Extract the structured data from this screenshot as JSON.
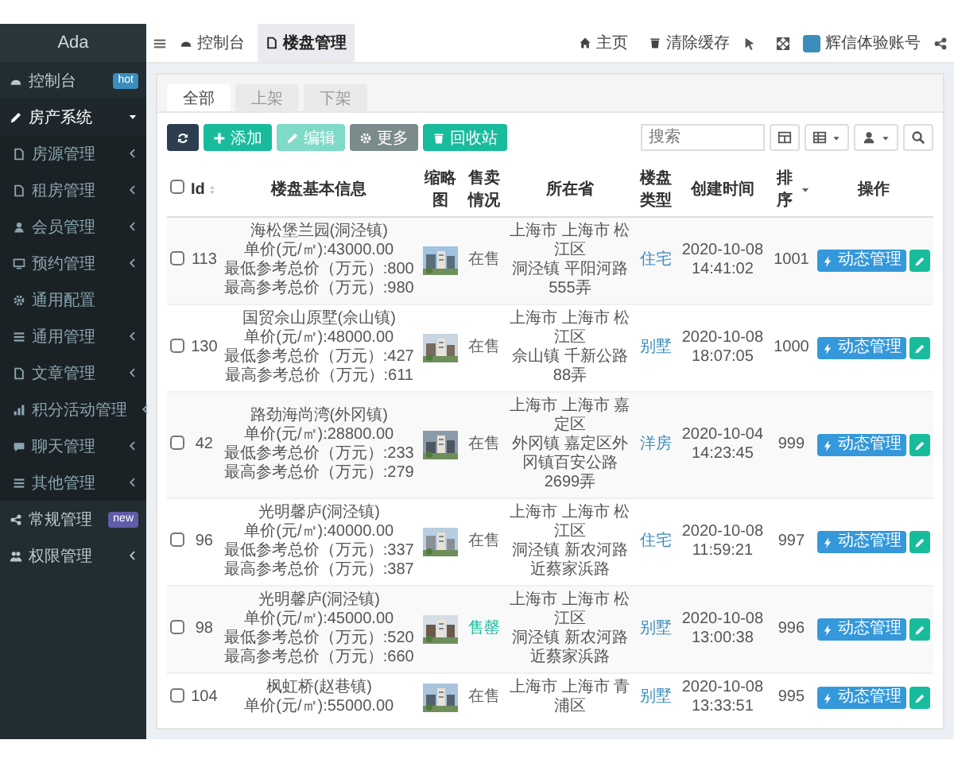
{
  "sidebar": {
    "logo": "Ada",
    "items": [
      {
        "label": "控制台",
        "kind": "link",
        "selected": false,
        "badge": {
          "text": "hot",
          "color": "#3c8dbc"
        }
      },
      {
        "label": "房产系统",
        "kind": "group",
        "selected": true,
        "expanded": true,
        "children": [
          {
            "label": "房源管理",
            "kind": "group",
            "selected": false,
            "expanded": false
          },
          {
            "label": "租房管理",
            "kind": "group",
            "selected": false,
            "expanded": false
          },
          {
            "label": "会员管理",
            "kind": "group",
            "selected": false,
            "expanded": false
          },
          {
            "label": "预约管理",
            "kind": "group",
            "selected": false,
            "expanded": false
          },
          {
            "label": "通用配置",
            "kind": "link",
            "selected": false
          },
          {
            "label": "通用管理",
            "kind": "group",
            "selected": false,
            "expanded": false
          },
          {
            "label": "文章管理",
            "kind": "group",
            "selected": false,
            "expanded": false
          },
          {
            "label": "积分活动管理",
            "kind": "group",
            "selected": false,
            "expanded": false
          },
          {
            "label": "聊天管理",
            "kind": "group",
            "selected": false,
            "expanded": false
          },
          {
            "label": "其他管理",
            "kind": "group",
            "selected": false,
            "expanded": false
          }
        ]
      },
      {
        "label": "常规管理",
        "kind": "link",
        "selected": false,
        "badge": {
          "text": "new",
          "color": "#605ca8"
        }
      },
      {
        "label": "权限管理",
        "kind": "group",
        "selected": false,
        "expanded": false
      }
    ]
  },
  "topbar": {
    "nav_tabs": [
      {
        "label": "控制台",
        "selected": false
      },
      {
        "label": "楼盘管理",
        "selected": true
      }
    ],
    "links": [
      {
        "label": "主页"
      },
      {
        "label": "清除缓存"
      }
    ],
    "user": {
      "name": "辉信体验账号"
    }
  },
  "filter_tabs": [
    {
      "label": "全部",
      "selected": true
    },
    {
      "label": "上架",
      "selected": false
    },
    {
      "label": "下架",
      "selected": false
    }
  ],
  "toolbar": {
    "buttons": [
      {
        "kind": "refresh",
        "disabled": false
      },
      {
        "kind": "add",
        "label": "添加",
        "disabled": false
      },
      {
        "kind": "edit",
        "label": "编辑",
        "disabled": true
      },
      {
        "kind": "more",
        "label": "更多",
        "disabled": false
      },
      {
        "kind": "recycle",
        "label": "回收站",
        "disabled": false
      }
    ],
    "search": {
      "placeholder": "搜索"
    }
  },
  "table": {
    "all_checked": false,
    "columns": [
      {
        "label": "Id",
        "kind": "sortable"
      },
      {
        "label": "楼盘基本信息",
        "kind": "plain"
      },
      {
        "label": "缩略图",
        "kind": "plain"
      },
      {
        "label": "售卖情况",
        "kind": "plain"
      },
      {
        "label": "所在省",
        "kind": "plain"
      },
      {
        "label": "楼盘类型",
        "kind": "plain"
      },
      {
        "label": "创建时间",
        "kind": "plain"
      },
      {
        "label": "排序",
        "kind": "sorted"
      },
      {
        "label": "操作",
        "kind": "plain"
      }
    ],
    "rows": [
      {
        "checked": false,
        "id": "113",
        "info": [
          "海松堡兰园(洞泾镇)",
          "单价(元/㎡):43000.00",
          "最低参考总价（万元）:800",
          "最高参考总价（万元）:980"
        ],
        "status": "在售",
        "sold_out": false,
        "address": [
          "上海市 上海市 松江区",
          "洞泾镇 平阳河路555弄"
        ],
        "type": "住宅",
        "created": "2020-10-08 14:41:02",
        "order": "1001",
        "action": "动态管理"
      },
      {
        "checked": false,
        "id": "130",
        "info": [
          "国贸佘山原墅(佘山镇)",
          "单价(元/㎡):48000.00",
          "最低参考总价（万元）:427",
          "最高参考总价（万元）:611"
        ],
        "status": "在售",
        "sold_out": false,
        "address": [
          "上海市 上海市 松江区",
          "佘山镇 千新公路88弄"
        ],
        "type": "别墅",
        "created": "2020-10-08 18:07:05",
        "order": "1000",
        "action": "动态管理"
      },
      {
        "checked": false,
        "id": "42",
        "info": [
          "路劲海尚湾(外冈镇)",
          "单价(元/㎡):28800.00",
          "最低参考总价（万元）:233",
          "最高参考总价（万元）:279"
        ],
        "status": "在售",
        "sold_out": false,
        "address": [
          "上海市 上海市 嘉定区",
          "外冈镇 嘉定区外冈镇百安公路2699弄"
        ],
        "type": "洋房",
        "created": "2020-10-04 14:23:45",
        "order": "999",
        "action": "动态管理"
      },
      {
        "checked": false,
        "id": "96",
        "info": [
          "光明馨庐(洞泾镇)",
          "单价(元/㎡):40000.00",
          "最低参考总价（万元）:337",
          "最高参考总价（万元）:387"
        ],
        "status": "在售",
        "sold_out": false,
        "address": [
          "上海市 上海市 松江区",
          "洞泾镇 新农河路近蔡家浜路"
        ],
        "type": "住宅",
        "created": "2020-10-08 11:59:21",
        "order": "997",
        "action": "动态管理"
      },
      {
        "checked": false,
        "id": "98",
        "info": [
          "光明馨庐(洞泾镇)",
          "单价(元/㎡):45000.00",
          "最低参考总价（万元）:520",
          "最高参考总价（万元）:660"
        ],
        "status": "售罄",
        "sold_out": true,
        "address": [
          "上海市 上海市 松江区",
          "洞泾镇 新农河路近蔡家浜路"
        ],
        "type": "别墅",
        "created": "2020-10-08 13:00:38",
        "order": "996",
        "action": "动态管理"
      },
      {
        "checked": false,
        "id": "104",
        "info": [
          "枫虹桥(赵巷镇)",
          "单价(元/㎡):55000.00"
        ],
        "status": "在售",
        "sold_out": false,
        "address": [
          "上海市 上海市 青浦区"
        ],
        "type": "别墅",
        "created": "2020-10-08 13:33:51",
        "order": "995",
        "action": "动态管理"
      }
    ]
  }
}
